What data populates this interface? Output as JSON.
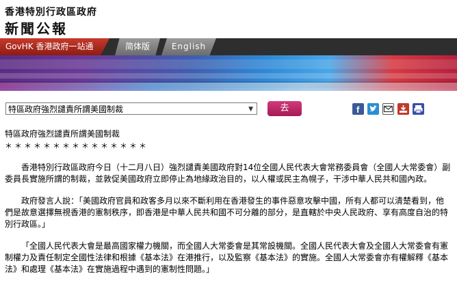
{
  "header": {
    "org": "香港特別行政區政府",
    "title": "新聞公報"
  },
  "nav": {
    "govhk": "GovHK 香港政府一站通",
    "simplified": "简体版",
    "english": "English"
  },
  "toolbar": {
    "select_value": "特區政府強烈譴責所謂美國制裁",
    "go_label": "去"
  },
  "share_icons": [
    "facebook-icon",
    "twitter-icon",
    "email-icon",
    "download-icon",
    "print-icon"
  ],
  "colors": {
    "brand_red": "#b62a1f",
    "go_button": "#c02a6b"
  },
  "article": {
    "title": "特區政府強烈譴責所謂美國制裁",
    "stars": "＊＊＊＊＊＊＊＊＊＊＊＊＊＊＊",
    "paragraphs": [
      "香港特別行政區政府今日（十二月八日）強烈譴責美國政府對14位全國人民代表大會常務委員會（全國人大常委會）副委員長實施所謂的制裁，並敦促美國政府立即停止為地緣政治目的，以人權或民主為幌子，干涉中華人民共和國內政。",
      "政府發言人說：「美國政府官員和政客多月以來不斷利用在香港發生的事件惡意攻擊中國，所有人都可以清楚看到，他們是故意選擇無視香港的憲制秩序，即香港是中華人民共和國不可分離的部分，是直轄於中央人民政府、享有高度自治的特別行政區。」",
      "「全國人民代表大會是最高國家權力機關，而全國人大常委會是其常設機關。全國人民代表大會及全國人大常委會有憲制權力及責任制定全國性法律和根據《基本法》在港推行，以及監察《基本法》的實施。全國人大常委會亦有權解釋《基本法》和處理《基本法》在實施過程中遇到的憲制性問題。」"
    ]
  }
}
